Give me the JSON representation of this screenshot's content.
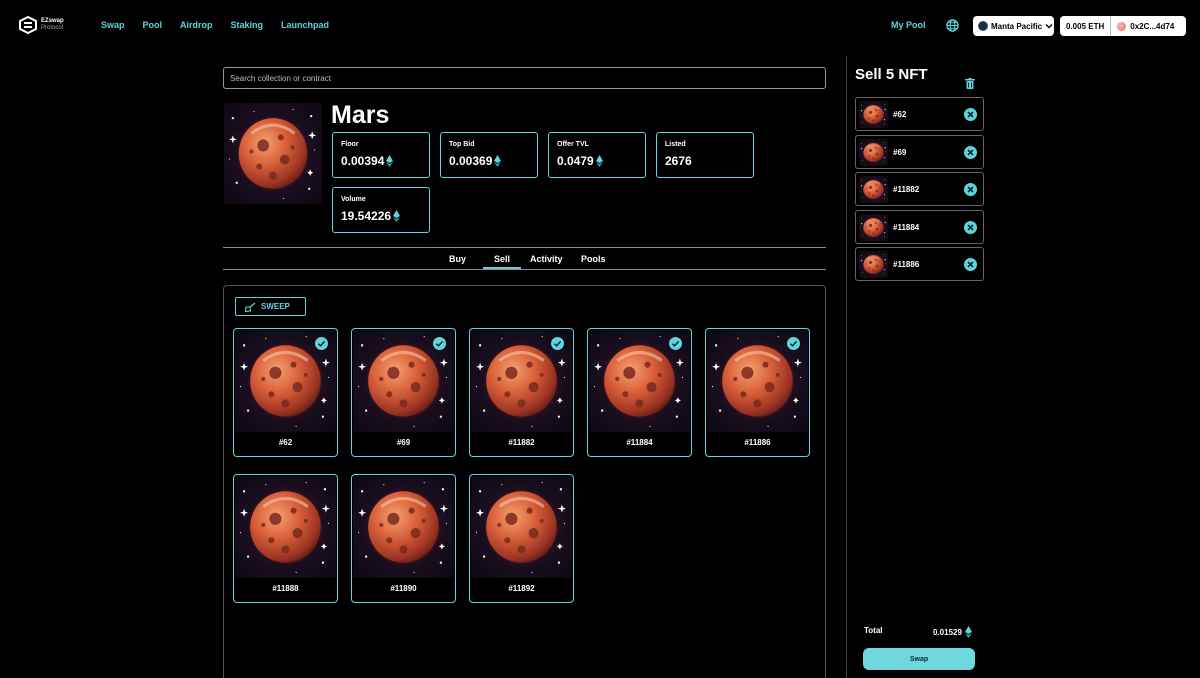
{
  "brand": {
    "name_line1": "EZswap",
    "name_line2": "Protocol"
  },
  "nav": {
    "items": [
      {
        "label": "Swap"
      },
      {
        "label": "Pool"
      },
      {
        "label": "Airdrop"
      },
      {
        "label": "Staking"
      },
      {
        "label": "Launchpad"
      }
    ],
    "my_pool": "My Pool",
    "globe_icon": "globe-icon",
    "chain": "Manta Pacific",
    "balance": "0.005 ETH",
    "address": "0x2C...4d74"
  },
  "search": {
    "placeholder": "Search collection or contract",
    "value": ""
  },
  "collection": {
    "name": "Mars",
    "stats": [
      {
        "label": "Floor",
        "value": "0.00394",
        "eth": true
      },
      {
        "label": "Top Bid",
        "value": "0.00369",
        "eth": true
      },
      {
        "label": "Offer TVL",
        "value": "0.0479",
        "eth": true
      },
      {
        "label": "Listed",
        "value": "2676",
        "eth": false
      },
      {
        "label": "Volume",
        "value": "19.54226",
        "eth": true
      }
    ]
  },
  "tabs": [
    {
      "label": "Buy",
      "active": false
    },
    {
      "label": "Sell",
      "active": true
    },
    {
      "label": "Activity",
      "active": false
    },
    {
      "label": "Pools",
      "active": false
    }
  ],
  "sweep_label": "SWEEP",
  "nfts": [
    {
      "id": "#62",
      "selected": true
    },
    {
      "id": "#69",
      "selected": true
    },
    {
      "id": "#11882",
      "selected": true
    },
    {
      "id": "#11884",
      "selected": true
    },
    {
      "id": "#11886",
      "selected": true
    },
    {
      "id": "#11888",
      "selected": false
    },
    {
      "id": "#11890",
      "selected": false
    },
    {
      "id": "#11892",
      "selected": false
    }
  ],
  "sell_panel": {
    "title": "Sell 5 NFT",
    "items": [
      "#62",
      "#69",
      "#11882",
      "#11884",
      "#11886"
    ],
    "total_label": "Total",
    "total_value": "0.01529",
    "swap_label": "Swap"
  },
  "colors": {
    "accent": "#5fd4dc",
    "button": "#6fd8df",
    "background": "#000000"
  }
}
